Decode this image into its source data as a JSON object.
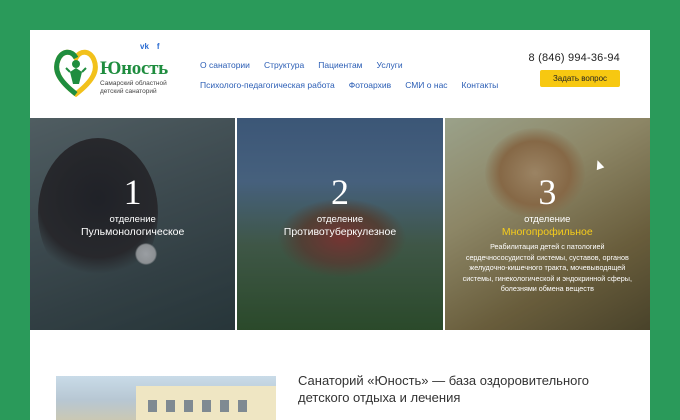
{
  "logo": {
    "title": "Юность",
    "subtitle_line1": "Самарский областной",
    "subtitle_line2": "детский санаторий"
  },
  "social": [
    "vk",
    "f"
  ],
  "nav": {
    "row1": [
      "О санатории",
      "Структура",
      "Пациентам",
      "Услуги"
    ],
    "row2": [
      "Психолого-педагогическая работа",
      "Фотоархив",
      "СМИ о нас",
      "Контакты"
    ]
  },
  "contact": {
    "phone": "8 (846) 994-36-94",
    "ask_button": "Задать вопрос"
  },
  "departments": [
    {
      "number": "1",
      "label": "отделение",
      "name": "Пульмонологическое"
    },
    {
      "number": "2",
      "label": "отделение",
      "name": "Противотуберкулезное"
    },
    {
      "number": "3",
      "label": "отделение",
      "name": "Многопрофильное",
      "description": "Реабилитация детей с патологией сердечнососудистой системы, суставов, органов желудочно-кишечного тракта, мочевыводящей системы, гинекологической и эндокринной сферы, болезнями обмена веществ"
    }
  ],
  "intro": {
    "headline": "Санаторий «Юность» — база оздоровительного детского отдыха и лечения"
  },
  "colors": {
    "background": "#2a9a5a",
    "brand_green": "#1f8d3f",
    "accent_yellow": "#f5cc1c",
    "link_blue": "#2a5db5"
  }
}
